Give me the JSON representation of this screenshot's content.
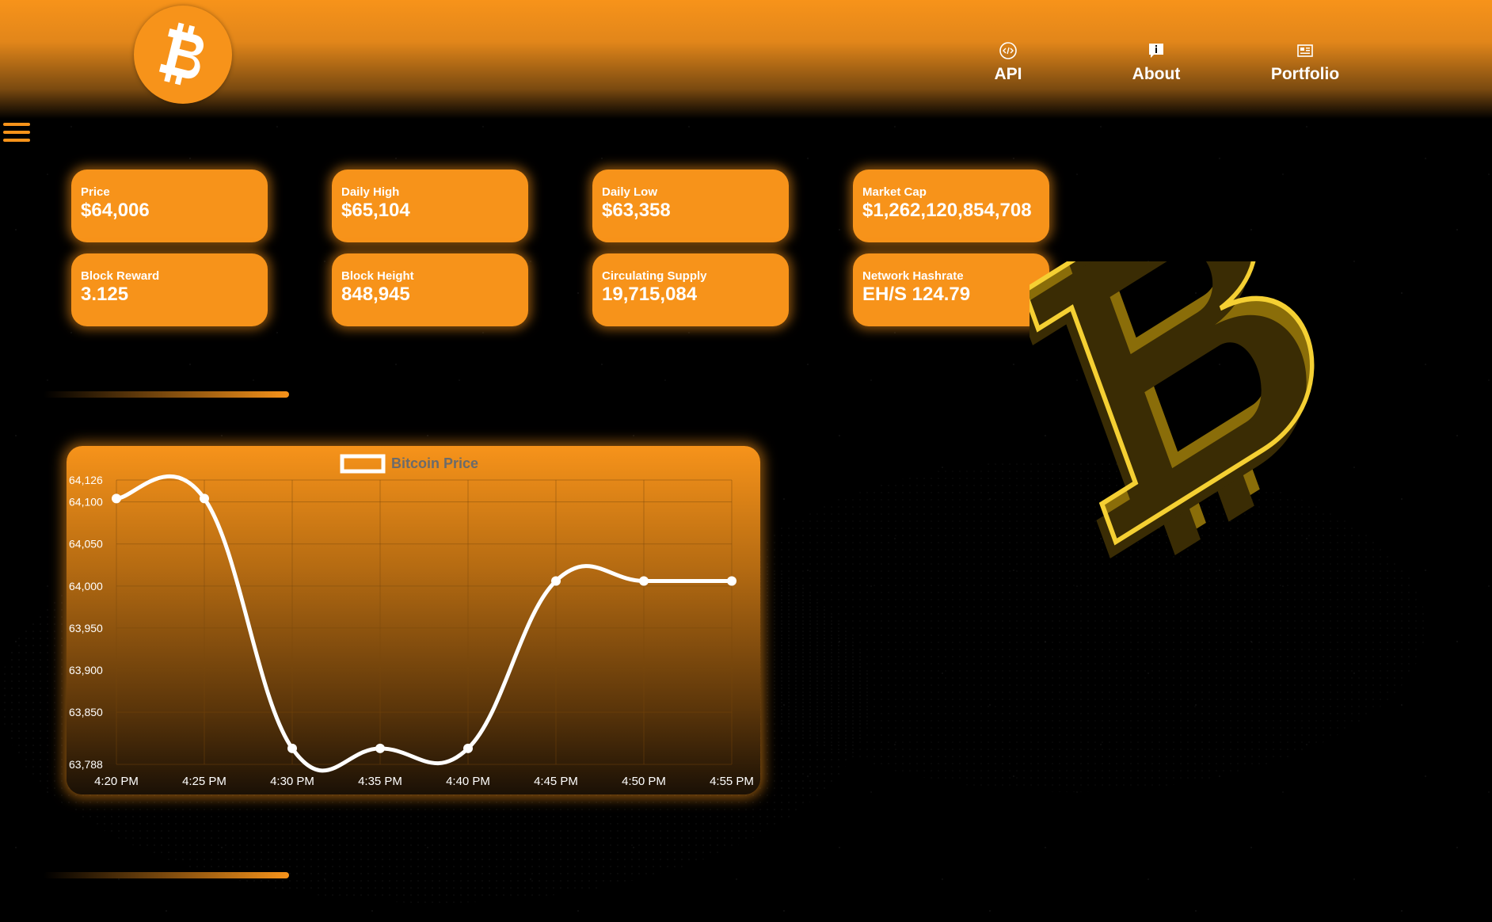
{
  "nav": {
    "items": [
      {
        "label": "API",
        "icon": "code-icon"
      },
      {
        "label": "About",
        "icon": "info-icon"
      },
      {
        "label": "Portfolio",
        "icon": "newspaper-icon"
      }
    ]
  },
  "logo": {
    "icon": "bitcoin-logo-icon",
    "color": "#f7931a"
  },
  "menu": {
    "icon": "hamburger-menu-icon"
  },
  "stats": [
    {
      "label": "Price",
      "value": "$64,006"
    },
    {
      "label": "Daily High",
      "value": "$65,104"
    },
    {
      "label": "Daily Low",
      "value": "$63,358"
    },
    {
      "label": "Market Cap",
      "value": "$1,262,120,854,708"
    },
    {
      "label": "Block Reward",
      "value": "3.125"
    },
    {
      "label": "Block Height",
      "value": "848,945"
    },
    {
      "label": "Circulating Supply",
      "value": "19,715,084"
    },
    {
      "label": "Network Hashrate",
      "value": "EH/S 124.79"
    }
  ],
  "chart_data": {
    "type": "line",
    "legend": "Bitcoin Price",
    "legend_position": "top-center",
    "categories": [
      "4:20 PM",
      "4:25 PM",
      "4:30 PM",
      "4:35 PM",
      "4:40 PM",
      "4:45 PM",
      "4:50 PM",
      "4:55 PM"
    ],
    "series": [
      {
        "name": "Bitcoin Price",
        "values": [
          64104,
          64104,
          63807,
          63807,
          63807,
          64006,
          64006,
          64006
        ]
      }
    ],
    "yticks": [
      "64,126",
      "64,100",
      "64,050",
      "64,000",
      "63,950",
      "63,900",
      "63,850",
      "63,788"
    ],
    "ylim": [
      63788,
      64126
    ],
    "grid": true,
    "line_color": "#ffffff"
  },
  "colors": {
    "accent": "#f7931a",
    "background": "#000000",
    "coin": "#f5d033"
  },
  "decoration": {
    "icon": "3d-bitcoin-symbol-icon"
  }
}
